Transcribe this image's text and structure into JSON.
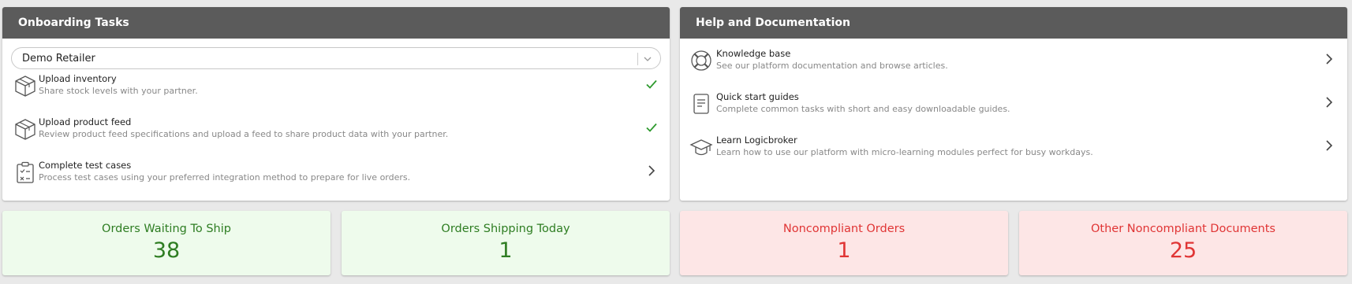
{
  "onboarding": {
    "title": "Onboarding Tasks",
    "partner_select": {
      "value": "Demo Retailer"
    },
    "tasks": [
      {
        "title": "Upload inventory",
        "description": "Share stock levels with your partner.",
        "status": "complete"
      },
      {
        "title": "Upload product feed",
        "description": "Review product feed specifications and upload a feed to share product data with your partner.",
        "status": "complete"
      },
      {
        "title": "Complete test cases",
        "description": "Process test cases using your preferred integration method to prepare for live orders.",
        "status": "open"
      }
    ]
  },
  "help": {
    "title": "Help and Documentation",
    "items": [
      {
        "title": "Knowledge base",
        "description": "See our platform documentation and browse articles.",
        "icon": "lifebuoy-icon"
      },
      {
        "title": "Quick start guides",
        "description": "Complete common tasks with short and easy downloadable guides.",
        "icon": "document-icon"
      },
      {
        "title": "Learn Logicbroker",
        "description": "Learn how to use our platform with micro-learning modules perfect for busy workdays.",
        "icon": "graduation-cap-icon"
      }
    ]
  },
  "stats": [
    {
      "label": "Orders Waiting To Ship",
      "value": "38",
      "tone": "green"
    },
    {
      "label": "Orders Shipping Today",
      "value": "1",
      "tone": "green"
    },
    {
      "label": "Noncompliant Orders",
      "value": "1",
      "tone": "red"
    },
    {
      "label": "Other Noncompliant Documents",
      "value": "25",
      "tone": "red"
    }
  ],
  "colors": {
    "header_bg": "#5b5b5b",
    "check_green": "#2e9a2e",
    "stat_green_bg": "#eefbec",
    "stat_green_text": "#2e7d22",
    "stat_red_bg": "#fde6e6",
    "stat_red_text": "#e03535"
  }
}
